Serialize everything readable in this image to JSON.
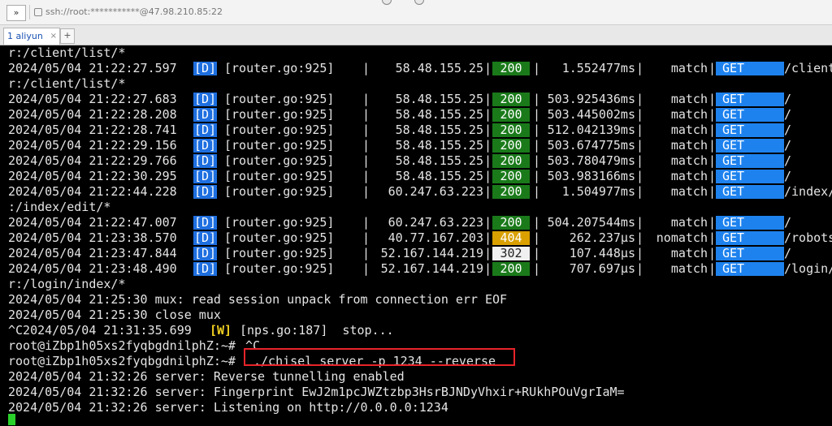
{
  "window": {
    "expand_label": "»",
    "address": "ssh://root:***********@47.98.210.85:22"
  },
  "tabs": {
    "active_label": "1 aliyun",
    "close_label": "×",
    "new_tab_label": "+"
  },
  "terminal": {
    "path1": "r:/client/list/*",
    "path2": "r:/client/list/*",
    "path3": ":/index/edit/*",
    "path4": "r:/login/index/*",
    "req": [
      {
        "ts": "2024/05/04 21:22:27.597",
        "lvl": "[D]",
        "src": "[router.go:925]",
        "ip": "58.48.155.25",
        "status": "200",
        "lat": "1.552477ms",
        "m": "match",
        "meth": "GET",
        "path": "/client"
      },
      {
        "ts": "2024/05/04 21:22:27.683",
        "lvl": "[D]",
        "src": "[router.go:925]",
        "ip": "58.48.155.25",
        "status": "200",
        "lat": "503.925436ms",
        "m": "match",
        "meth": "GET",
        "path": "/"
      },
      {
        "ts": "2024/05/04 21:22:28.208",
        "lvl": "[D]",
        "src": "[router.go:925]",
        "ip": "58.48.155.25",
        "status": "200",
        "lat": "503.445002ms",
        "m": "match",
        "meth": "GET",
        "path": "/"
      },
      {
        "ts": "2024/05/04 21:22:28.741",
        "lvl": "[D]",
        "src": "[router.go:925]",
        "ip": "58.48.155.25",
        "status": "200",
        "lat": "512.042139ms",
        "m": "match",
        "meth": "GET",
        "path": "/"
      },
      {
        "ts": "2024/05/04 21:22:29.156",
        "lvl": "[D]",
        "src": "[router.go:925]",
        "ip": "58.48.155.25",
        "status": "200",
        "lat": "503.674775ms",
        "m": "match",
        "meth": "GET",
        "path": "/"
      },
      {
        "ts": "2024/05/04 21:22:29.766",
        "lvl": "[D]",
        "src": "[router.go:925]",
        "ip": "58.48.155.25",
        "status": "200",
        "lat": "503.780479ms",
        "m": "match",
        "meth": "GET",
        "path": "/"
      },
      {
        "ts": "2024/05/04 21:22:30.295",
        "lvl": "[D]",
        "src": "[router.go:925]",
        "ip": "58.48.155.25",
        "status": "200",
        "lat": "503.983166ms",
        "m": "match",
        "meth": "GET",
        "path": "/"
      },
      {
        "ts": "2024/05/04 21:22:44.228",
        "lvl": "[D]",
        "src": "[router.go:925]",
        "ip": "60.247.63.223",
        "status": "200",
        "lat": "1.504977ms",
        "m": "match",
        "meth": "GET",
        "path": "/index/"
      },
      {
        "ts": "2024/05/04 21:22:47.007",
        "lvl": "[D]",
        "src": "[router.go:925]",
        "ip": "60.247.63.223",
        "status": "200",
        "lat": "504.207544ms",
        "m": "match",
        "meth": "GET",
        "path": "/"
      },
      {
        "ts": "2024/05/04 21:23:38.570",
        "lvl": "[D]",
        "src": "[router.go:925]",
        "ip": "40.77.167.203",
        "status": "404",
        "lat": "262.237µs",
        "m": "nomatch",
        "meth": "GET",
        "path": "/robots"
      },
      {
        "ts": "2024/05/04 21:23:47.844",
        "lvl": "[D]",
        "src": "[router.go:925]",
        "ip": "52.167.144.219",
        "status": "302",
        "lat": "107.448µs",
        "m": "match",
        "meth": "GET",
        "path": "/"
      },
      {
        "ts": "2024/05/04 21:23:48.490",
        "lvl": "[D]",
        "src": "[router.go:925]",
        "ip": "52.167.144.219",
        "status": "200",
        "lat": "707.697µs",
        "m": "match",
        "meth": "GET",
        "path": "/login/"
      }
    ],
    "mux1": "2024/05/04 21:25:30 mux: read session unpack from connection err EOF",
    "mux2": "2024/05/04 21:25:30 close mux",
    "stop_pre": "^C2024/05/04 21:31:35.699",
    "stop_lvl": "[W]",
    "stop_post": "[nps.go:187]  stop...",
    "prompt": "root@iZbp1h05xs2fyqbgdnilphZ:~#",
    "cmd1": "^C",
    "cmd2": "./chisel server -p 1234 --reverse",
    "out1": "2024/05/04 21:32:26 server: Reverse tunnelling enabled",
    "out2": "2024/05/04 21:32:26 server: Fingerprint EwJ2m1pcJWZtzbp3HsrBJNDyVhxir+RUkhPOuVgrIaM=",
    "out3": "2024/05/04 21:32:26 server: Listening on http://0.0.0.0:1234"
  },
  "colors": {
    "debug_badge": "#1e6fe0",
    "ok_status": "#1a7a1a",
    "notfound_status": "#d9a000",
    "redirect_status": "#f0f0f0",
    "method_badge": "#1e82ee",
    "highlight_box": "#e8232a",
    "cursor": "#2ad02a"
  }
}
